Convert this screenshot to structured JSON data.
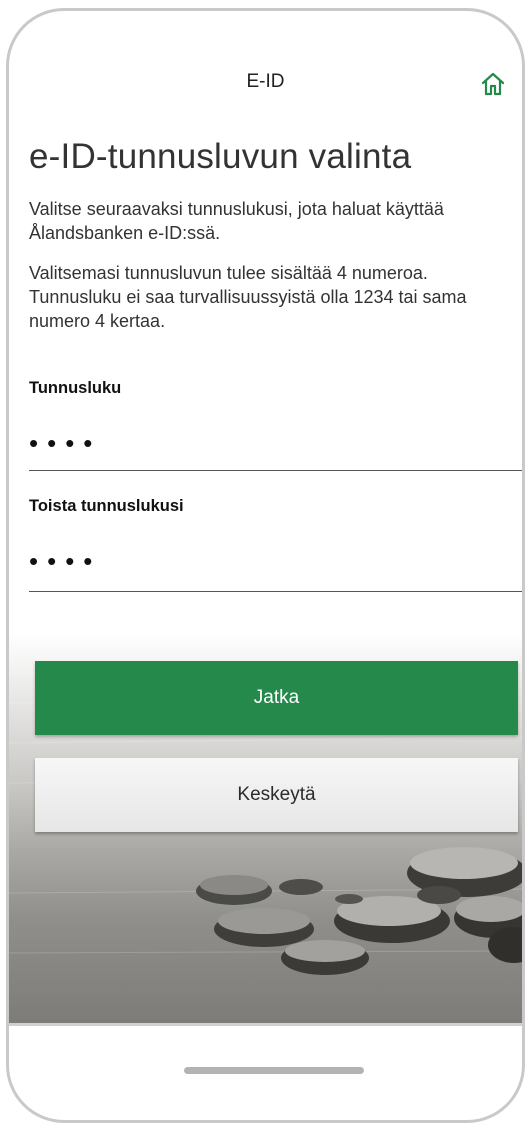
{
  "header": {
    "title": "E-ID",
    "home_icon": "home-icon"
  },
  "page": {
    "title": "e-ID-tunnusluvun valinta",
    "description_1": "Valitse seuraavaksi tunnuslukusi, jota haluat käyttää Ålandsbanken e-ID:ssä.",
    "description_2": "Valitsemasi tunnusluvun tulee sisältää 4 numeroa. Tunnusluku ei saa turvallisuussyistä olla 1234 tai sama numero 4 kertaa."
  },
  "form": {
    "pin_label": "Tunnusluku",
    "pin_value": "••••",
    "repeat_label": "Toista tunnuslukusi",
    "repeat_value": "••••"
  },
  "actions": {
    "continue_label": "Jatka",
    "cancel_label": "Keskeytä"
  },
  "colors": {
    "accent": "#25894b",
    "text": "#333333"
  }
}
